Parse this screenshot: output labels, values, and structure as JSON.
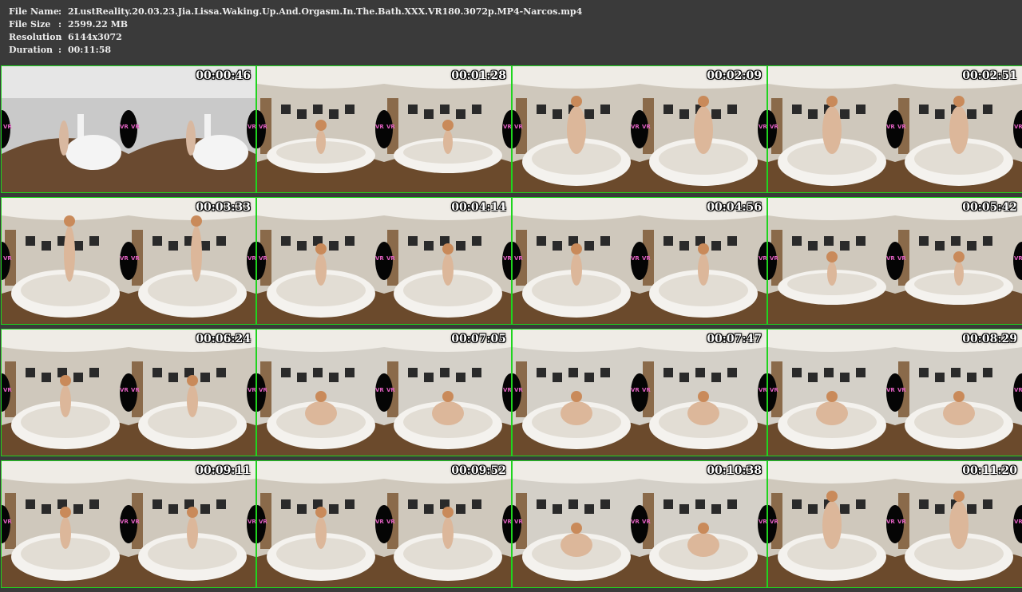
{
  "info": {
    "file_name": {
      "label": "File Name",
      "value": "2LustReality.20.03.23.Jia.Lissa.Waking.Up.And.Orgasm.In.The.Bath.XXX.VR180.3072p.MP4-Narcos.mp4"
    },
    "file_size": {
      "label": "File Size",
      "value": "2599.22 MB"
    },
    "resolution": {
      "label": "Resolution",
      "value": "6144x3072"
    },
    "duration": {
      "label": "Duration",
      "value": "00:11:58"
    },
    "separator": ":"
  },
  "colors": {
    "background": "#3a3a3a",
    "header_text": "#ececec",
    "cell_border": "#1fd41f",
    "timestamp_text": "#ffffff"
  },
  "watermark": "VR",
  "thumbnails": [
    {
      "time": "00:00:46",
      "scene": "bedroom"
    },
    {
      "time": "00:01:28",
      "scene": "bath-wide"
    },
    {
      "time": "00:02:09",
      "scene": "bath-close"
    },
    {
      "time": "00:02:51",
      "scene": "bath-close"
    },
    {
      "time": "00:03:33",
      "scene": "bath-standing"
    },
    {
      "time": "00:04:14",
      "scene": "bath-kneel"
    },
    {
      "time": "00:04:56",
      "scene": "bath-kneel"
    },
    {
      "time": "00:05:42",
      "scene": "bath-wide"
    },
    {
      "time": "00:06:24",
      "scene": "bath-kneel"
    },
    {
      "time": "00:07:05",
      "scene": "bath-recline"
    },
    {
      "time": "00:07:47",
      "scene": "bath-recline"
    },
    {
      "time": "00:08:29",
      "scene": "bath-recline"
    },
    {
      "time": "00:09:11",
      "scene": "bath-kneel"
    },
    {
      "time": "00:09:52",
      "scene": "bath-kneel"
    },
    {
      "time": "00:10:38",
      "scene": "bath-recline"
    },
    {
      "time": "00:11:20",
      "scene": "bath-close"
    }
  ]
}
